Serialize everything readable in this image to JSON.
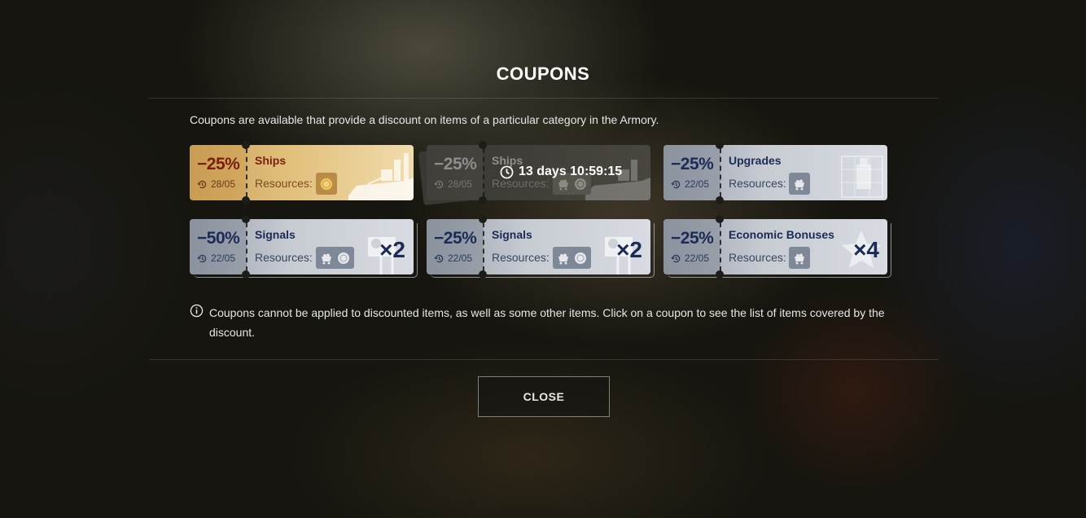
{
  "dialog": {
    "title": "COUPONS",
    "intro": "Coupons are available that provide a discount on items of a particular category in the Armory.",
    "note": "Coupons cannot be applied to discounted items, as well as some other items. Click on a coupon to see the list of items covered by the discount.",
    "close_label": "CLOSE"
  },
  "resources_label": "Resources:",
  "timer": "13 days 10:59:15",
  "coupons": [
    {
      "discount": "−25%",
      "expires": "28/05",
      "category": "Ships",
      "resources": [
        "gold"
      ],
      "style": "gold"
    },
    {
      "discount": "−25%",
      "expires": "28/05",
      "category": "Ships",
      "resources": [
        "coal",
        "credits"
      ],
      "style": "disabled"
    },
    {
      "discount": "−25%",
      "expires": "22/05",
      "category": "Upgrades",
      "resources": [
        "coal"
      ],
      "style": "silver"
    },
    {
      "discount": "−50%",
      "expires": "22/05",
      "category": "Signals",
      "resources": [
        "coal",
        "credits"
      ],
      "multiplier": "×2",
      "style": "silver"
    },
    {
      "discount": "−25%",
      "expires": "22/05",
      "category": "Signals",
      "resources": [
        "coal",
        "credits"
      ],
      "multiplier": "×2",
      "style": "silver"
    },
    {
      "discount": "−25%",
      "expires": "22/05",
      "category": "Economic Bonuses",
      "resources": [
        "coal"
      ],
      "multiplier": "×4",
      "style": "silver"
    }
  ],
  "colors": {
    "gold_coupon": "#e2c07c",
    "silver_coupon": "#c7cbd2",
    "discount_text": "#1c2b56",
    "gold_discount_text": "#7a1e0e"
  },
  "icons": [
    "clock-history-icon",
    "gold-coin-icon",
    "coal-cart-icon",
    "silver-credits-icon",
    "timer-clock-icon",
    "info-icon",
    "ship-art",
    "upgrade-art",
    "signal-flag-art",
    "star-art"
  ]
}
